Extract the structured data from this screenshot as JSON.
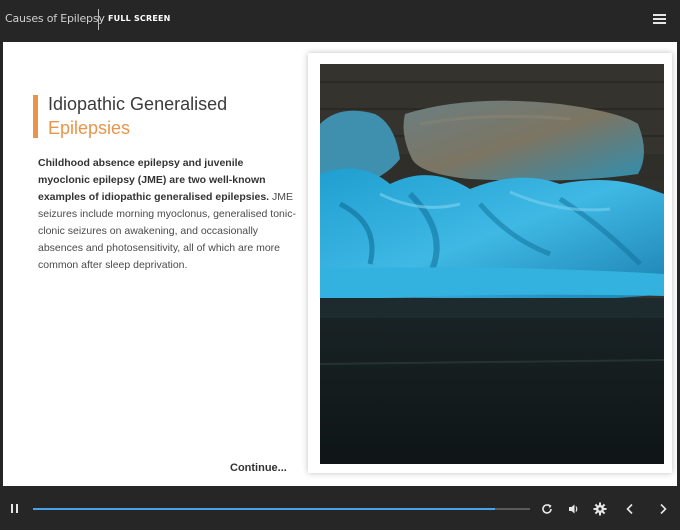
{
  "header": {
    "course_title": "Causes of Epilepsy",
    "fullscreen_label": "FULL SCREEN",
    "menu_icon": "hamburger-menu-icon"
  },
  "slide": {
    "heading_line1": "Idiopathic Generalised",
    "heading_line2": "Epilepsies",
    "body_bold": "Childhood absence epilepsy and juvenile myoclonic epilepsy (JME) are two well-known examples of idiopathic generalised epilepsies.",
    "body_regular": " JME seizures include morning myoclonus, generalised tonic-clonic seizures on awakening, and occasionally absences and photosensitivity, all of which are more common after sleep deprivation.",
    "continue_label": "Continue...",
    "image": "unmade-bed-photo"
  },
  "player": {
    "progress_fraction": 0.93,
    "icons": [
      "pause-icon",
      "replay-icon",
      "volume-icon",
      "settings-gear-icon",
      "previous-chevron-icon",
      "next-chevron-icon"
    ],
    "accent_color": "#4aa3e8"
  },
  "colors": {
    "heading_accent": "#e8954a",
    "background": "#262626"
  }
}
